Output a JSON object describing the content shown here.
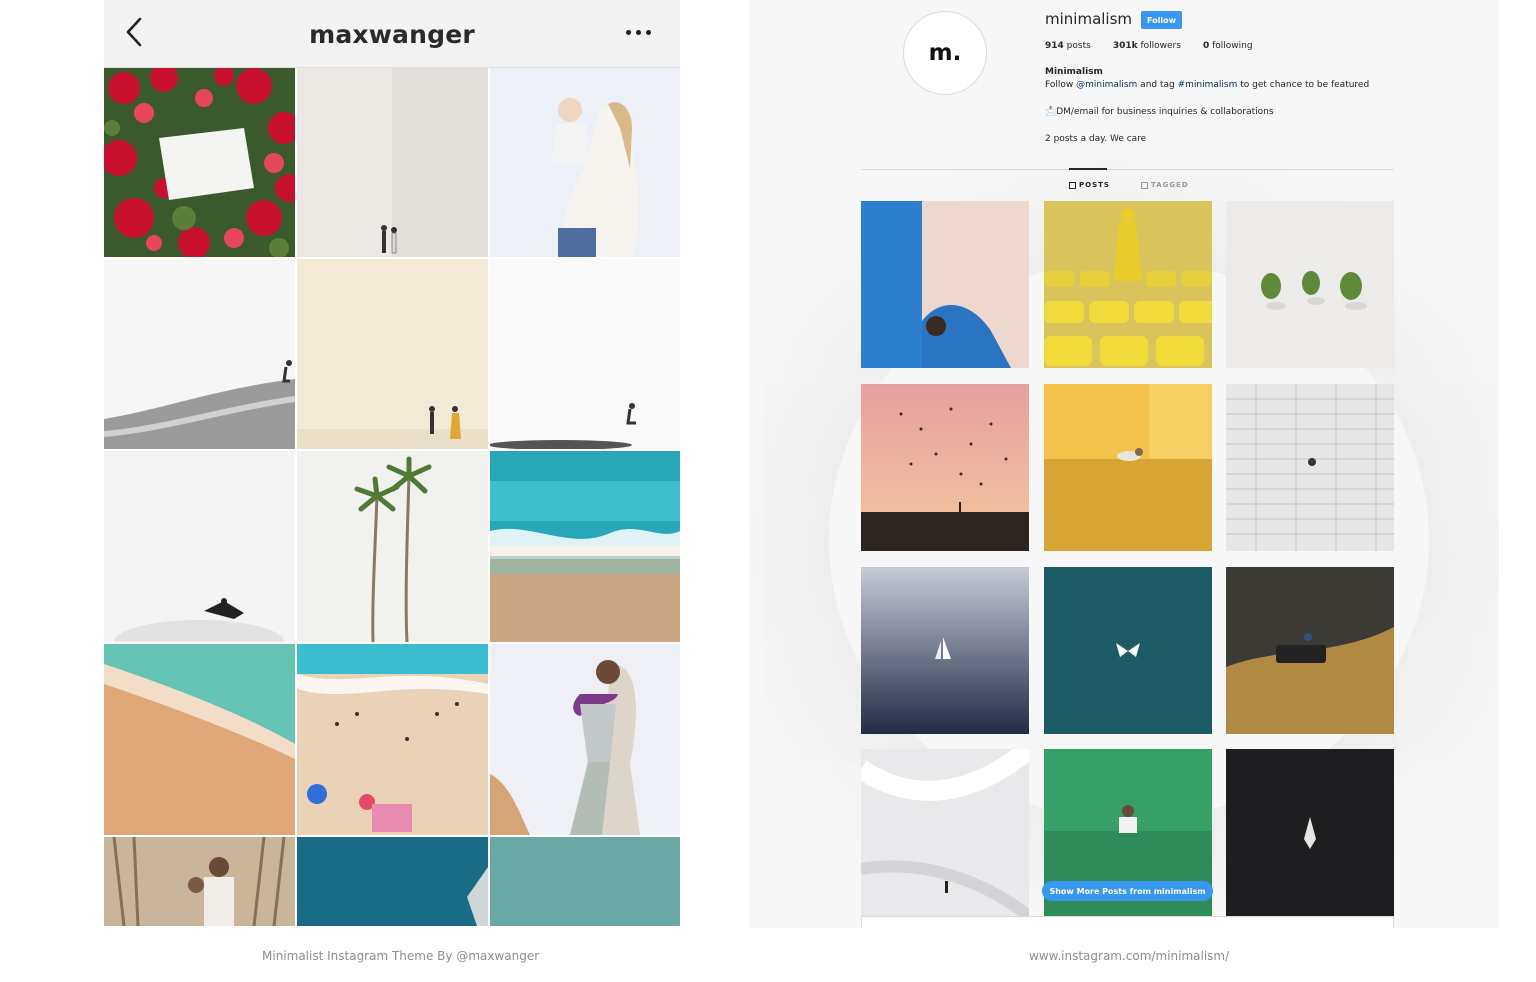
{
  "left_panel": {
    "header": {
      "username": "maxwanger",
      "back_icon": "chevron-left-icon",
      "more_icon": "more-dots-icon"
    },
    "photos": [
      "bougainvillea-sign",
      "beige-couple",
      "mother-baby",
      "skater-wall",
      "cream-couple",
      "skateboarder-white",
      "skater-dome",
      "palm-trees",
      "turquoise-wave",
      "aerial-shore",
      "beach-people",
      "lei-woman",
      "palm-family",
      "deep-teal",
      "teal-water"
    ],
    "caption": "Minimalist Instagram Theme By @maxwanger"
  },
  "right_panel": {
    "avatar_text": "m.",
    "username": "minimalism",
    "follow_label": "Follow",
    "stats": {
      "posts": "914",
      "posts_label": "posts",
      "followers": "301k",
      "followers_label": "followers",
      "following": "0",
      "following_label": "following"
    },
    "bio": {
      "name": "Minimalism",
      "line1_a": "Follow ",
      "line1_mention": "@minimalism",
      "line1_b": " and tag ",
      "line1_hashtag": "#minimalism",
      "line1_c": " to get chance to be featured",
      "line2": "📩DM/email for business inquiries & collaborations",
      "line3": "2 posts a day. We care"
    },
    "tabs": {
      "posts": "POSTS",
      "tagged": "TAGGED"
    },
    "photos": [
      "blue-wall-woman",
      "yellow-stadium",
      "three-plants",
      "pink-sky-birds",
      "yellow-wall-cat",
      "white-brick-wall",
      "misty-sailboat",
      "teal-butterfly",
      "car-hill",
      "white-tunnel",
      "green-wall-man",
      "dark-boat"
    ],
    "show_more_label": "Show More Posts from minimalism",
    "caption": "www.instagram.com/minimalism/"
  },
  "colors": {
    "accent_blue": "#3897f0",
    "link_blue": "#003569"
  }
}
